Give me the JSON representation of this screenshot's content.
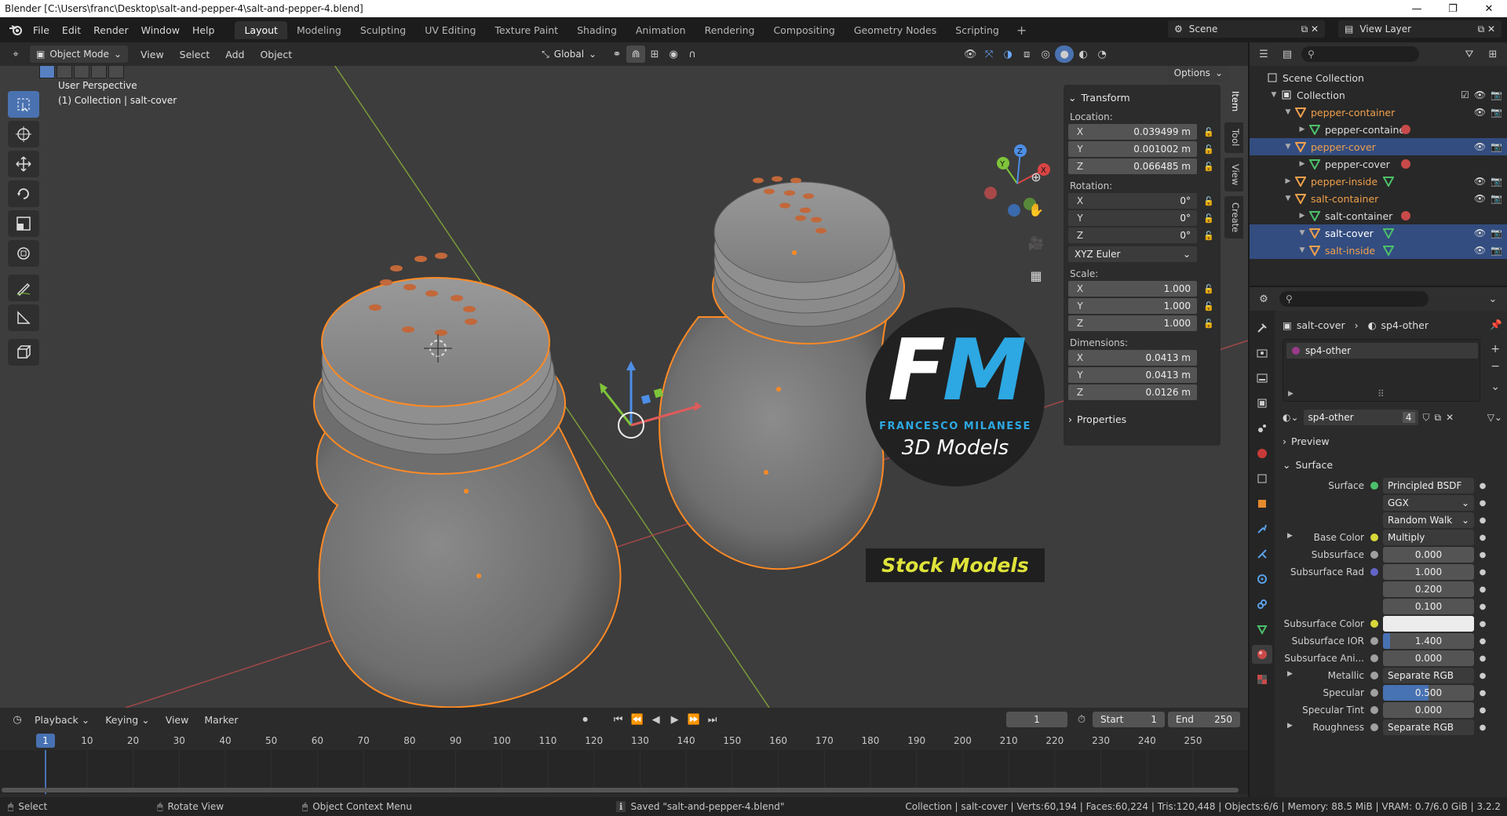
{
  "window": {
    "title": "Blender [C:\\Users\\franc\\Desktop\\salt-and-pepper-4\\salt-and-pepper-4.blend]"
  },
  "menu": [
    "File",
    "Edit",
    "Render",
    "Window",
    "Help"
  ],
  "workspaces": [
    "Layout",
    "Modeling",
    "Sculpting",
    "UV Editing",
    "Texture Paint",
    "Shading",
    "Animation",
    "Rendering",
    "Compositing",
    "Geometry Nodes",
    "Scripting"
  ],
  "scene": {
    "name": "Scene",
    "view_layer": "View Layer"
  },
  "viewport_header": {
    "mode": "Object Mode",
    "menus": [
      "View",
      "Select",
      "Add",
      "Object"
    ],
    "orientation": "Global",
    "options": "Options"
  },
  "viewport": {
    "perspective": "User Perspective",
    "collection_info": "(1) Collection | salt-cover"
  },
  "npanel": {
    "tabs": [
      "Item",
      "Tool",
      "View",
      "Create"
    ],
    "transform": "Transform",
    "location_label": "Location:",
    "location": {
      "x": "0.039499 m",
      "y": "0.001002 m",
      "z": "0.066485 m"
    },
    "rotation_label": "Rotation:",
    "rotation": {
      "x": "0°",
      "y": "0°",
      "z": "0°"
    },
    "rotation_mode": "XYZ Euler",
    "scale_label": "Scale:",
    "scale": {
      "x": "1.000",
      "y": "1.000",
      "z": "1.000"
    },
    "dimensions_label": "Dimensions:",
    "dimensions": {
      "x": "0.0413 m",
      "y": "0.0413 m",
      "z": "0.0126 m"
    },
    "properties": "Properties",
    "axes": [
      "X",
      "Y",
      "Z"
    ]
  },
  "watermark": {
    "letter1": "F",
    "letter2": "M",
    "name": "FRANCESCO MILANESE",
    "subtitle": "3D Models",
    "banner": "Stock Models"
  },
  "timeline": {
    "menus": [
      "Playback",
      "Keying",
      "View",
      "Marker"
    ],
    "current_frame": "1",
    "start_label": "Start",
    "start": "1",
    "end_label": "End",
    "end": "250",
    "ruler": [
      "1",
      "10",
      "20",
      "30",
      "40",
      "50",
      "60",
      "70",
      "80",
      "90",
      "100",
      "110",
      "120",
      "130",
      "140",
      "150",
      "160",
      "170",
      "180",
      "190",
      "200",
      "210",
      "220",
      "230",
      "240",
      "250"
    ]
  },
  "outliner": {
    "search_placeholder": "",
    "rows": [
      {
        "name": "Scene Collection",
        "indent": 0,
        "type": "scene",
        "sel": false
      },
      {
        "name": "Collection",
        "indent": 1,
        "type": "collection",
        "sel": false
      },
      {
        "name": "pepper-container",
        "indent": 2,
        "type": "empty",
        "sel": false,
        "orange": true
      },
      {
        "name": "pepper-container",
        "indent": 3,
        "type": "mesh",
        "sel": false
      },
      {
        "name": "pepper-cover",
        "indent": 2,
        "type": "empty",
        "sel": true,
        "orange": true
      },
      {
        "name": "pepper-cover",
        "indent": 3,
        "type": "mesh",
        "sel": false
      },
      {
        "name": "pepper-inside",
        "indent": 2,
        "type": "empty",
        "sel": false,
        "orange": true
      },
      {
        "name": "salt-container",
        "indent": 2,
        "type": "empty",
        "sel": false,
        "orange": true
      },
      {
        "name": "salt-container",
        "indent": 3,
        "type": "mesh",
        "sel": false
      },
      {
        "name": "salt-cover",
        "indent": 3,
        "type": "empty",
        "sel": true,
        "orange": true,
        "active": true
      },
      {
        "name": "salt-inside",
        "indent": 3,
        "type": "empty",
        "sel": true,
        "orange": true
      }
    ]
  },
  "properties": {
    "breadcrumb_object": "salt-cover",
    "breadcrumb_material": "sp4-other",
    "material_slot": "sp4-other",
    "material_name": "sp4-other",
    "material_users": "4",
    "preview": "Preview",
    "surface_section": "Surface",
    "rows": [
      {
        "label": "Surface",
        "value": "Principled BSDF",
        "sock": "#4cc06a",
        "kind": "dark"
      },
      {
        "label": "",
        "value": "GGX",
        "sock": "",
        "kind": "dd"
      },
      {
        "label": "",
        "value": "Random Walk",
        "sock": "",
        "kind": "dd"
      },
      {
        "label": "Base Color",
        "value": "Multiply",
        "sock": "#d8d83a",
        "kind": "dark",
        "expand": true
      },
      {
        "label": "Subsurface",
        "value": "0.000",
        "sock": "#a0a0a0",
        "kind": "num"
      },
      {
        "label": "Subsurface Rad",
        "value": "1.000",
        "sock": "#6464c8",
        "kind": "num"
      },
      {
        "label": "",
        "value": "0.200",
        "sock": "",
        "kind": "num"
      },
      {
        "label": "",
        "value": "0.100",
        "sock": "",
        "kind": "num"
      },
      {
        "label": "Subsurface Color",
        "value": "",
        "sock": "#d8d83a",
        "kind": "color"
      },
      {
        "label": "Subsurface IOR",
        "value": "1.400",
        "sock": "#a0a0a0",
        "kind": "bar",
        "fill": 0.08
      },
      {
        "label": "Subsurface Ani...",
        "value": "0.000",
        "sock": "#a0a0a0",
        "kind": "num"
      },
      {
        "label": "Metallic",
        "value": "Separate RGB",
        "sock": "#a0a0a0",
        "kind": "dark",
        "expand": true
      },
      {
        "label": "Specular",
        "value": "0.500",
        "sock": "#a0a0a0",
        "kind": "bar",
        "fill": 0.5
      },
      {
        "label": "Specular Tint",
        "value": "0.000",
        "sock": "#a0a0a0",
        "kind": "num"
      },
      {
        "label": "Roughness",
        "value": "Separate RGB",
        "sock": "#a0a0a0",
        "kind": "dark",
        "expand": true
      }
    ]
  },
  "statusbar": {
    "select": "Select",
    "rotate": "Rotate View",
    "context": "Object Context Menu",
    "saved": "Saved \"salt-and-pepper-4.blend\"",
    "stats": "Collection | salt-cover | Verts:60,194 | Faces:60,224 | Tris:120,448 | Objects:6/6 | Memory: 88.5 MiB | VRAM: 0.7/6.0 GiB | 3.2.2"
  },
  "colors": {
    "accent": "#4772b3",
    "selection": "#f0a04b",
    "outline": "#ff8a24",
    "bg_viewport": "#3d3d3d"
  }
}
